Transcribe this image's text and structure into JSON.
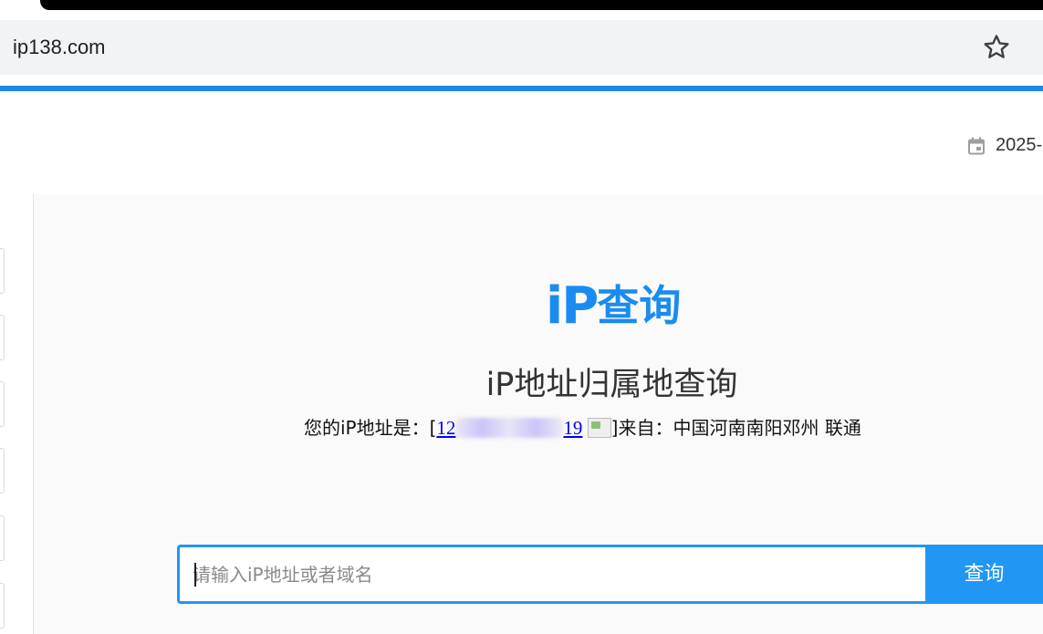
{
  "browser": {
    "url": "ip138.com",
    "bookmark_icon": "star-outline-icon"
  },
  "header": {
    "calendar_icon": "calendar-icon",
    "date": "2025-"
  },
  "logo": {
    "ip": "iP",
    "cn": "查询"
  },
  "main": {
    "heading": "iP地址归属地查询",
    "my_ip_label": "您的iP地址是：[",
    "my_ip_start": "12",
    "my_ip_end": "19",
    "my_ip_from": "]来自：中国河南南阳邓州 联通"
  },
  "search": {
    "placeholder": "请输入iP地址或者域名",
    "value": "",
    "button_label": "查询"
  },
  "colors": {
    "accent": "#2196f3",
    "logo": "#1a8cf0"
  }
}
